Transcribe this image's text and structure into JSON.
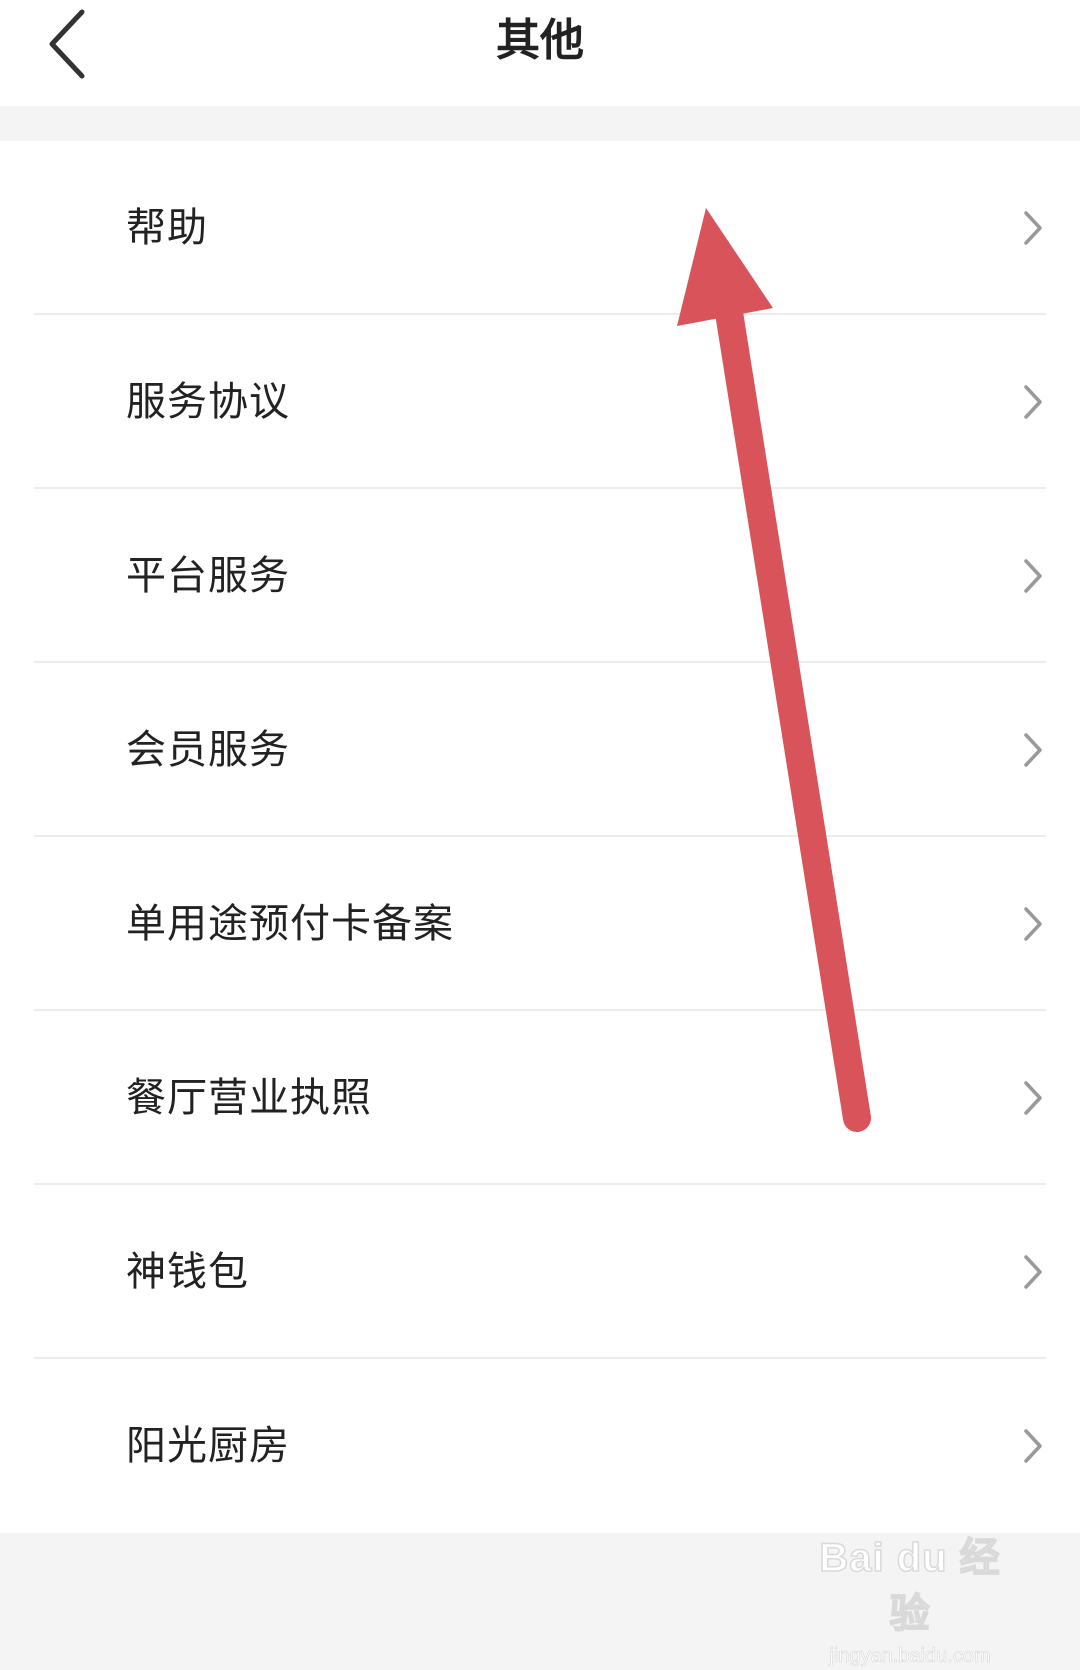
{
  "header": {
    "title": "其他",
    "back_icon": "chevron-left-icon"
  },
  "menu": {
    "chevron_icon": "chevron-right-icon",
    "items": [
      {
        "label": "帮助"
      },
      {
        "label": "服务协议"
      },
      {
        "label": "平台服务"
      },
      {
        "label": "会员服务"
      },
      {
        "label": "单用途预付卡备案"
      },
      {
        "label": "餐厅营业执照"
      },
      {
        "label": "神钱包"
      },
      {
        "label": "阳光厨房"
      }
    ]
  },
  "annotation": {
    "color": "#d9535a",
    "icon": "arrow-up-icon"
  },
  "watermark": {
    "logo": "Bai du 经验",
    "url": "jingyan.baidu.com"
  }
}
